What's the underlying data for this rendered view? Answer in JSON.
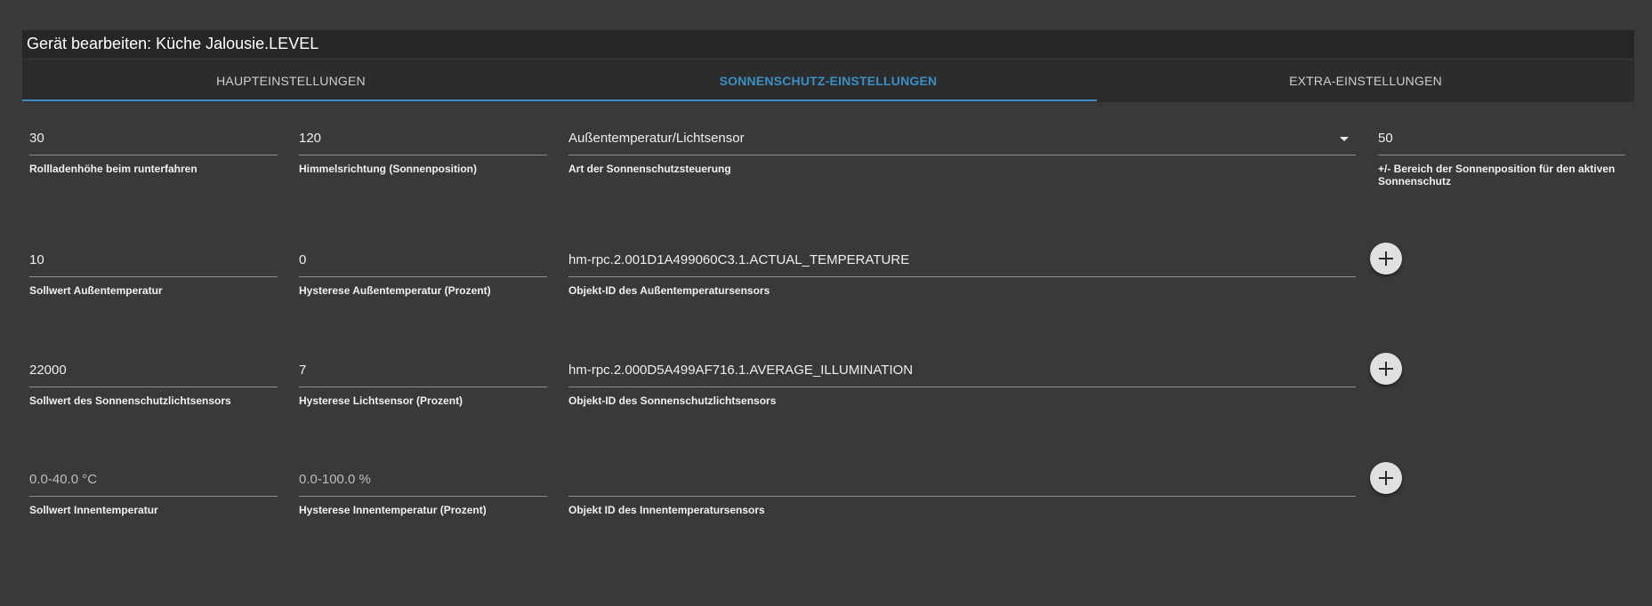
{
  "dialog": {
    "title": "Gerät bearbeiten: Küche Jalousie.LEVEL"
  },
  "tabs": [
    {
      "label": "HAUPTEINSTELLUNGEN",
      "active": false
    },
    {
      "label": "SONNENSCHUTZ-EINSTELLUNGEN",
      "active": true
    },
    {
      "label": "EXTRA-EINSTELLUNGEN",
      "active": false
    }
  ],
  "colors": {
    "accent": "#3a8fc4",
    "background": "#393939",
    "titlebar": "#262626"
  },
  "fields": {
    "shutter_height": {
      "value": "30",
      "label": "Rollladenhöhe beim runterfahren"
    },
    "sky_direction": {
      "value": "120",
      "label": "Himmelsrichtung (Sonnenposition)"
    },
    "control_type": {
      "value": "Außentemperatur/Lichtsensor",
      "label": "Art der Sonnenschutzsteuerung"
    },
    "sun_range": {
      "value": "50",
      "label": "+/- Bereich der Sonnenposition für den aktiven Sonnenschutz"
    },
    "outside_temp_setpoint": {
      "value": "10",
      "label": "Sollwert Außentemperatur"
    },
    "outside_temp_hysteresis": {
      "value": "0",
      "label": "Hysterese Außentemperatur (Prozent)"
    },
    "outside_temp_sensor": {
      "value": "hm-rpc.2.001D1A499060C3.1.ACTUAL_TEMPERATURE",
      "label": "Objekt-ID des Außentemperatursensors"
    },
    "light_setpoint": {
      "value": "22000",
      "label": "Sollwert des Sonnenschutzlichtsensors"
    },
    "light_hysteresis": {
      "value": "7",
      "label": "Hysterese Lichtsensor (Prozent)"
    },
    "light_sensor": {
      "value": "hm-rpc.2.000D5A499AF716.1.AVERAGE_ILLUMINATION",
      "label": "Objekt-ID des Sonnenschutzlichtsensors"
    },
    "inside_temp_setpoint": {
      "placeholder": "0.0-40.0 °C",
      "label": "Sollwert Innentemperatur"
    },
    "inside_temp_hysteresis": {
      "placeholder": "0.0-100.0 %",
      "label": "Hysterese Innentemperatur (Prozent)"
    },
    "inside_temp_sensor": {
      "value": "",
      "label": "Objekt ID des Innentemperatursensors"
    }
  },
  "icons": {
    "add": "plus-icon",
    "dropdown": "caret-down-icon"
  }
}
